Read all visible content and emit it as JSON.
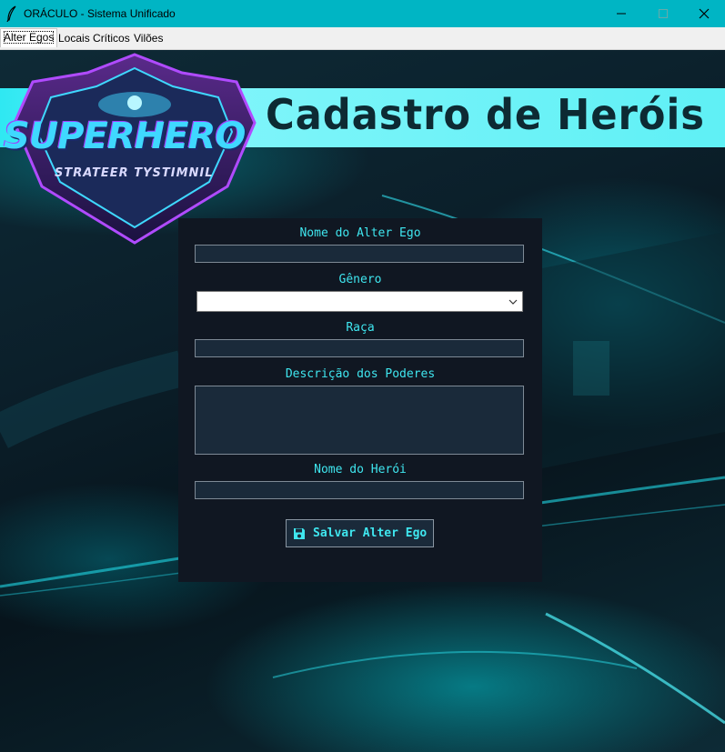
{
  "window": {
    "title": "ORÁCULO - Sistema Unificado",
    "icons": [
      "feather-icon",
      "minimize-icon",
      "maximize-icon",
      "close-icon"
    ]
  },
  "tabs": [
    {
      "label": "Alter Egos",
      "active": true
    },
    {
      "label": "Locais Críticos",
      "active": false
    },
    {
      "label": "Vilões",
      "active": false
    }
  ],
  "banner": {
    "title": "Cadastro de Heróis",
    "logo_text": "SUPERHERO",
    "logo_subtext": "STRATEER TYSTIMNIL"
  },
  "form": {
    "alter_ego_label": "Nome do Alter Ego",
    "alter_ego_value": "",
    "genero_label": "Gênero",
    "genero_value": "",
    "raca_label": "Raça",
    "raca_value": "",
    "poderes_label": "Descrição dos Poderes",
    "poderes_value": "",
    "heroi_label": "Nome do Herói",
    "heroi_value": "",
    "save_label": "Salvar Alter Ego",
    "save_icon": "floppy-disk-icon"
  },
  "colors": {
    "titlebar": "#00b5c4",
    "panel": "#101722",
    "accent_text": "#3fe6ef",
    "banner": "#5ff0f5"
  }
}
